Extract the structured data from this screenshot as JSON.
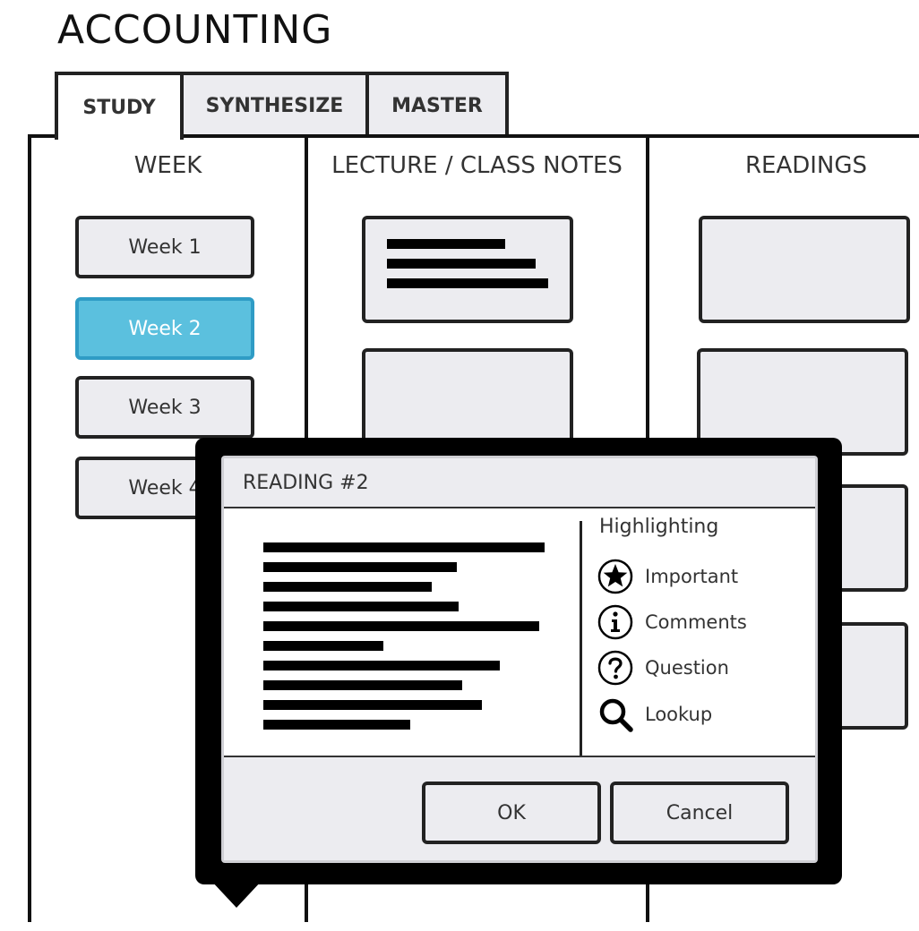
{
  "app": {
    "title": "ACCOUNTING"
  },
  "tabs": [
    {
      "label": "STUDY"
    },
    {
      "label": "SYNTHESIZE"
    },
    {
      "label": "MASTER"
    }
  ],
  "columns": {
    "week": "WEEK",
    "lecture": "LECTURE / CLASS NOTES",
    "readings": "READINGS"
  },
  "weeks": [
    {
      "label": "Week 1"
    },
    {
      "label": "Week 2",
      "selected": true
    },
    {
      "label": "Week 3"
    },
    {
      "label": "Week 4"
    }
  ],
  "dialog": {
    "title": "READING #2",
    "highlighting": {
      "title": "Highlighting",
      "items": [
        {
          "label": "Important",
          "icon": "star-icon"
        },
        {
          "label": "Comments",
          "icon": "info-icon"
        },
        {
          "label": "Question",
          "icon": "question-icon"
        },
        {
          "label": "Lookup",
          "icon": "magnifier-icon"
        }
      ]
    },
    "ok_label": "OK",
    "cancel_label": "Cancel"
  },
  "colors": {
    "selected": "#5bc0de",
    "panel": "#ececf0",
    "ink": "#000000"
  }
}
